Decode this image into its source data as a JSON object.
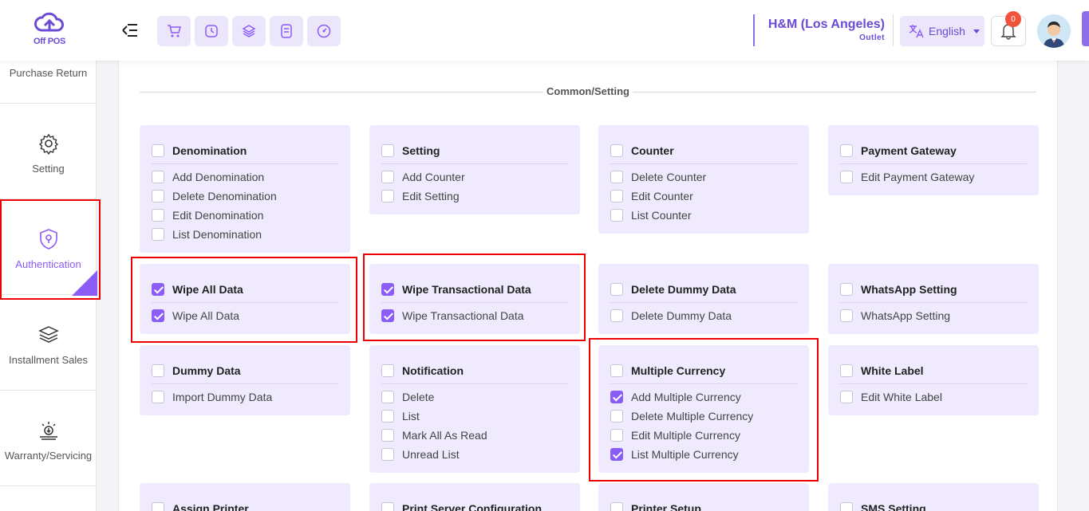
{
  "app": {
    "logo_text": "Off POS"
  },
  "outlet": {
    "name": "H&M (Los Angeles)",
    "label": "Outlet"
  },
  "language": {
    "selected": "English"
  },
  "notifications": {
    "count": "0"
  },
  "sidebar": {
    "items": [
      {
        "label": "Purchase Return",
        "icon": "purchase-return-icon"
      },
      {
        "label": "Setting",
        "icon": "gear-icon"
      },
      {
        "label": "Authentication",
        "icon": "shield-icon",
        "active": true
      },
      {
        "label": "Installment Sales",
        "icon": "layers-icon"
      },
      {
        "label": "Warranty/Servicing",
        "icon": "warranty-icon"
      }
    ]
  },
  "section": {
    "title": "Common/Setting"
  },
  "colors": {
    "accent": "#8b5cf6",
    "card_bg": "#efeafd",
    "highlight": "#ee0000"
  },
  "cards": [
    {
      "title": "Denomination",
      "checked": false,
      "items": [
        {
          "label": "Add Denomination",
          "checked": false
        },
        {
          "label": "Delete Denomination",
          "checked": false
        },
        {
          "label": "Edit Denomination",
          "checked": false
        },
        {
          "label": "List Denomination",
          "checked": false
        }
      ]
    },
    {
      "title": "Setting",
      "checked": false,
      "items": [
        {
          "label": "Add Counter",
          "checked": false
        },
        {
          "label": "Edit Setting",
          "checked": false
        }
      ]
    },
    {
      "title": "Counter",
      "checked": false,
      "items": [
        {
          "label": "Delete Counter",
          "checked": false
        },
        {
          "label": "Edit Counter",
          "checked": false
        },
        {
          "label": "List Counter",
          "checked": false
        }
      ]
    },
    {
      "title": "Payment Gateway",
      "checked": false,
      "items": [
        {
          "label": "Edit Payment Gateway",
          "checked": false
        }
      ]
    },
    {
      "title": "Wipe All Data",
      "checked": true,
      "items": [
        {
          "label": "Wipe All Data",
          "checked": true
        }
      ]
    },
    {
      "title": "Wipe Transactional Data",
      "checked": true,
      "items": [
        {
          "label": "Wipe Transactional Data",
          "checked": true
        }
      ]
    },
    {
      "title": "Delete Dummy Data",
      "checked": false,
      "items": [
        {
          "label": "Delete Dummy Data",
          "checked": false
        }
      ]
    },
    {
      "title": "WhatsApp Setting",
      "checked": false,
      "items": [
        {
          "label": "WhatsApp Setting",
          "checked": false
        }
      ]
    },
    {
      "title": "Dummy Data",
      "checked": false,
      "items": [
        {
          "label": "Import Dummy Data",
          "checked": false
        }
      ]
    },
    {
      "title": "Notification",
      "checked": false,
      "items": [
        {
          "label": "Delete",
          "checked": false
        },
        {
          "label": "List",
          "checked": false
        },
        {
          "label": "Mark All As Read",
          "checked": false
        },
        {
          "label": "Unread List",
          "checked": false
        }
      ]
    },
    {
      "title": "Multiple Currency",
      "checked": false,
      "items": [
        {
          "label": "Add Multiple Currency",
          "checked": true
        },
        {
          "label": "Delete Multiple Currency",
          "checked": false
        },
        {
          "label": "Edit Multiple Currency",
          "checked": false
        },
        {
          "label": "List Multiple Currency",
          "checked": true
        }
      ]
    },
    {
      "title": "White Label",
      "checked": false,
      "items": [
        {
          "label": "Edit White Label",
          "checked": false
        }
      ]
    },
    {
      "title": "Assign Printer",
      "checked": false,
      "items": []
    },
    {
      "title": "Print Server Configuration",
      "checked": false,
      "items": []
    },
    {
      "title": "Printer Setup",
      "checked": false,
      "items": []
    },
    {
      "title": "SMS Setting",
      "checked": false,
      "items": []
    }
  ]
}
